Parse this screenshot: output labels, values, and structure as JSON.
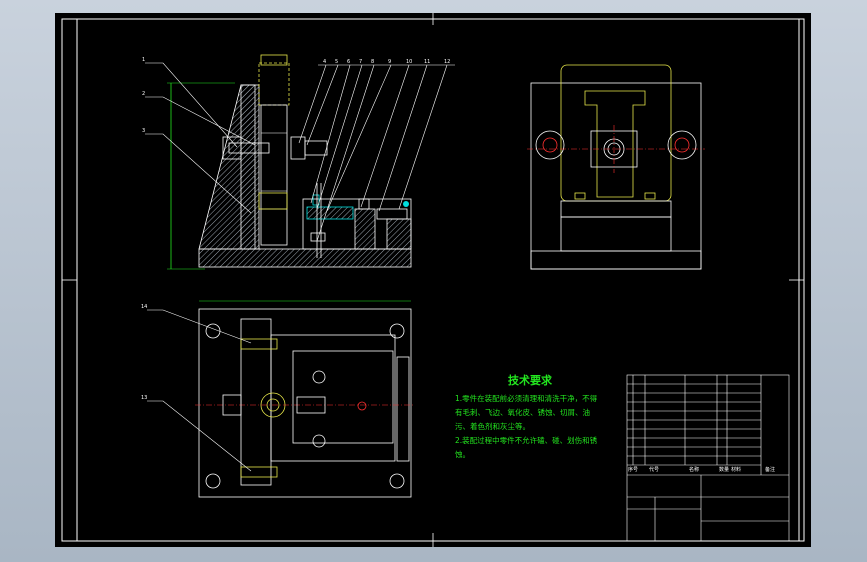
{
  "technical_requirements": {
    "title": "技术要求",
    "lines": [
      "1.零件在装配前必须清理和清洗干净，不得",
      "有毛刺、飞边、氧化皮、锈蚀、切屑、油",
      "污、着色剂和灰尘等。",
      "2.装配过程中零件不允许磕、碰、划伤和锈",
      "蚀。"
    ]
  },
  "balloons": {
    "top": [
      "1",
      "2",
      "3",
      "4",
      "5",
      "6",
      "7",
      "8",
      "9",
      "10",
      "11",
      "12"
    ],
    "bottom": [
      "14",
      "13"
    ]
  },
  "title_block": {
    "header_labels": [
      "序号",
      "代号",
      "名称",
      "数量",
      "材料",
      "备注"
    ]
  },
  "colors": {
    "background": "#000000",
    "outline": "#ffffff",
    "green": "#23e61f",
    "yellow": "#e8e84a",
    "red": "#ff3030",
    "cyan": "#00e0e0",
    "hatch": "#9aa3ad"
  }
}
